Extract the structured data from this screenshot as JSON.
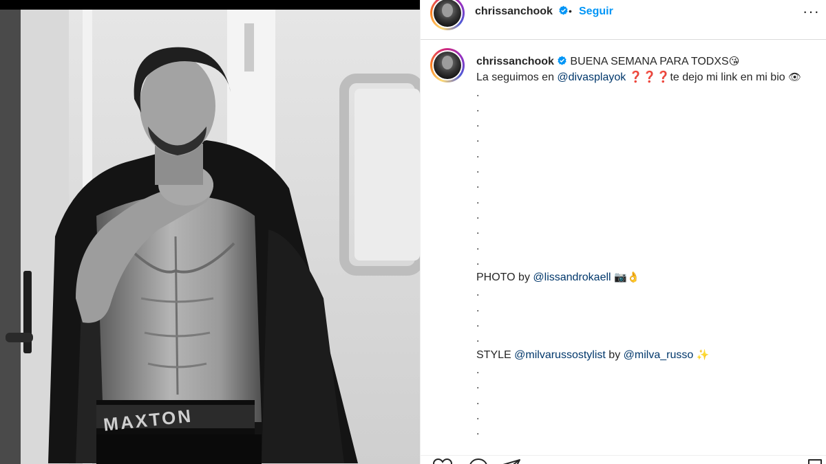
{
  "post": {
    "username": "chrissanchook",
    "follow_label": "Seguir",
    "separator": "•",
    "more_label": "···"
  },
  "caption": {
    "username": "chrissanchook",
    "line1_text": "BUENA SEMANA PARA TODXS",
    "line1_emoji": "😘",
    "line2_prefix": "La seguimos en ",
    "line2_mention": "@divasplayok",
    "line2_marks": "❓❓❓",
    "line2_suffix": "te dejo mi link en mi bio",
    "line2_emoji": "👁",
    "dots_a": [
      ".",
      ".",
      ".",
      ".",
      ".",
      ".",
      ".",
      ".",
      ".",
      ".",
      ".",
      "."
    ],
    "photo_prefix": "PHOTO by ",
    "photo_mention": "@lissandrokaell",
    "photo_emoji": "📷👌",
    "dots_b": [
      ".",
      ".",
      ".",
      "."
    ],
    "style_prefix": "STYLE ",
    "style_mention1": "@milvarussostylist",
    "style_mid": " by ",
    "style_mention2": "@milva_russo",
    "style_emoji": "✨",
    "dots_c": [
      ".",
      ".",
      ".",
      ".",
      "."
    ]
  },
  "photo": {
    "brand_text": "MAXTON"
  },
  "icons": [
    "verified-icon",
    "more-icon",
    "heart-icon",
    "comment-icon",
    "share-icon",
    "bookmark-icon"
  ],
  "colors": {
    "accent": "#0095f6",
    "mention": "#00376b",
    "text": "#262626",
    "border": "#dbdbdb"
  }
}
